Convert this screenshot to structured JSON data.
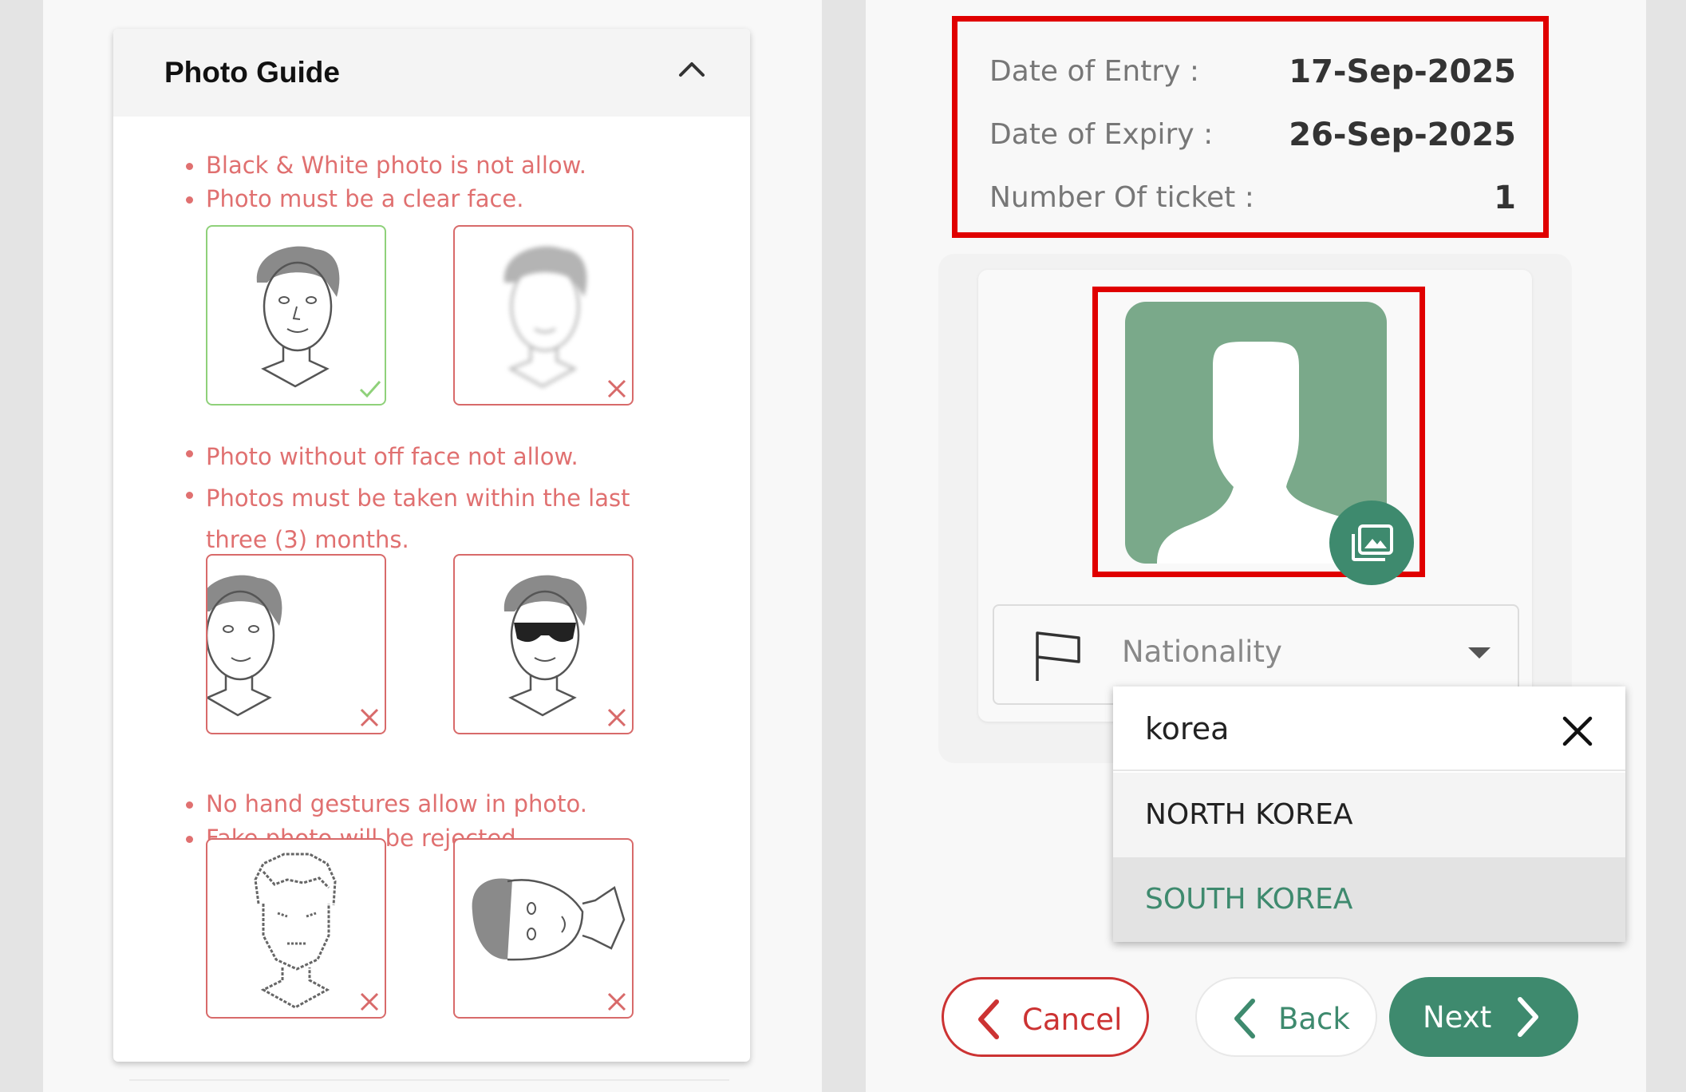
{
  "photo_guide": {
    "title": "Photo Guide",
    "rules_group_1": [
      "Black & White photo is not allow.",
      "Photo must be a clear face."
    ],
    "rules_group_2": [
      "Photo without off face not allow.",
      "Photos must be taken within the last three (3) months."
    ],
    "rules_group_3": [
      "No hand gestures allow in photo.",
      "Fake photo will be rejected."
    ]
  },
  "ticket_info": {
    "entry_label": "Date of Entry :",
    "entry_value": "17-Sep-2025",
    "expiry_label": "Date of Expiry :",
    "expiry_value": "26-Sep-2025",
    "tickets_label": "Number Of ticket :",
    "tickets_value": "1"
  },
  "nationality": {
    "label": "Nationality",
    "search_value": "korea",
    "options": [
      "NORTH KOREA",
      "SOUTH KOREA"
    ]
  },
  "buttons": {
    "cancel": "Cancel",
    "back": "Back",
    "next": "Next"
  },
  "colors": {
    "accent_green": "#3e8a6e",
    "avatar_green": "#7aa98a",
    "error_red": "#e07070",
    "highlight_red": "#e00000"
  }
}
